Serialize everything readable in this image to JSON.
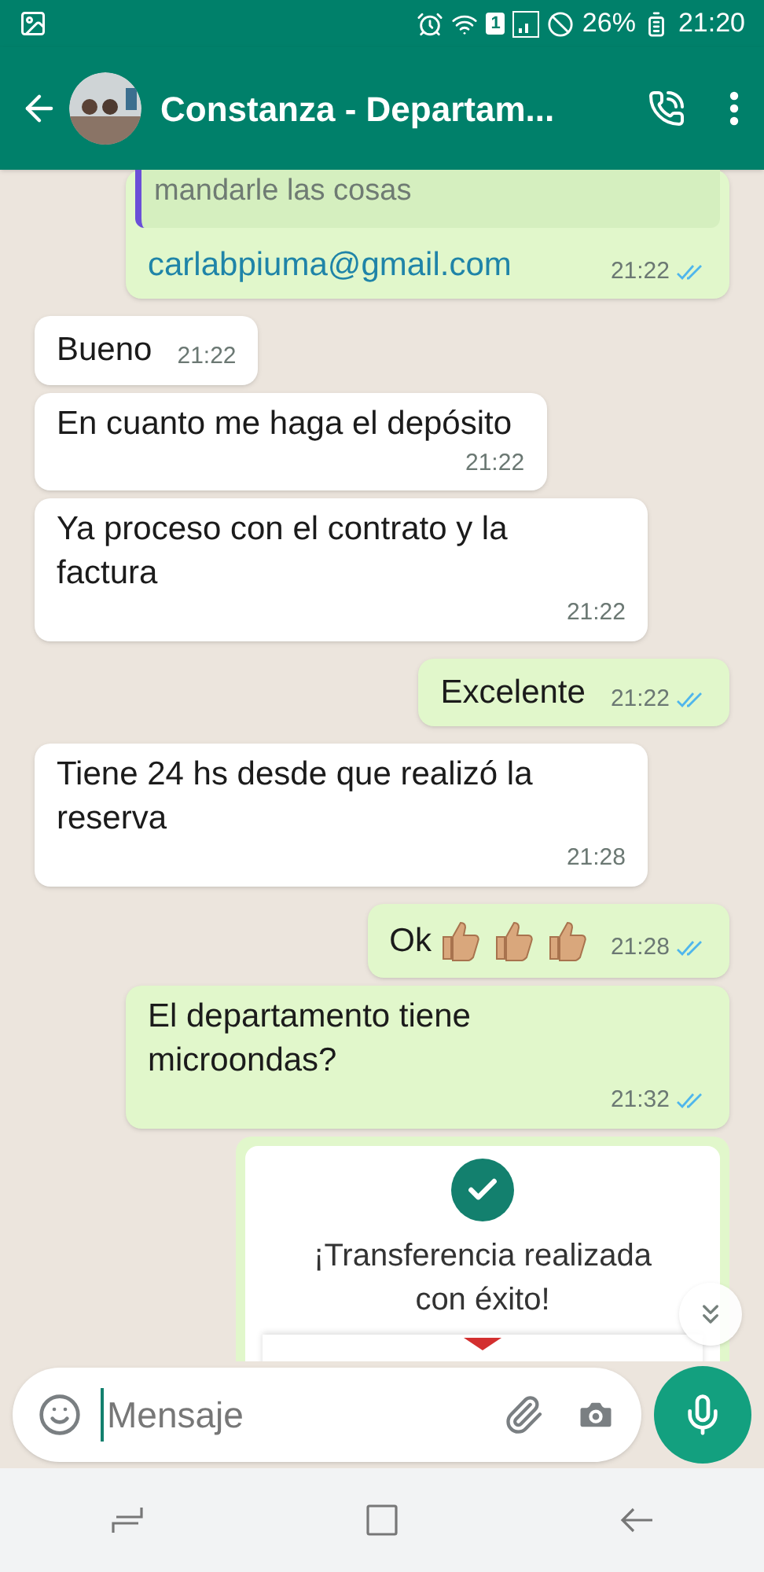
{
  "status_bar": {
    "battery": "26%",
    "time": "21:20",
    "sim": "1"
  },
  "header": {
    "title": "Constanza - Departam..."
  },
  "messages": [
    {
      "kind": "quoted",
      "outgoing": true,
      "quote": "mandarle las cosas",
      "link": "carlabpiuma@gmail.com",
      "time": "21:22",
      "read": true
    },
    {
      "kind": "text",
      "outgoing": false,
      "text": "Bueno",
      "time": "21:22",
      "inline": true
    },
    {
      "kind": "text",
      "outgoing": false,
      "text": "En cuanto me haga el depósito",
      "time": "21:22",
      "inline": false
    },
    {
      "kind": "text",
      "outgoing": false,
      "text": "Ya proceso con el contrato y la factura",
      "time": "21:22",
      "inline": false
    },
    {
      "kind": "text",
      "outgoing": true,
      "text": "Excelente",
      "time": "21:22",
      "read": true,
      "inline": true
    },
    {
      "kind": "text",
      "outgoing": false,
      "text": "Tiene 24 hs desde que realizó la reserva",
      "time": "21:28",
      "inline": false
    },
    {
      "kind": "emoji",
      "outgoing": true,
      "text": "Ok",
      "emoji": [
        {
          "kind": "thumbs-up"
        },
        {
          "kind": "thumbs-up"
        },
        {
          "kind": "thumbs-up"
        }
      ],
      "time": "21:28",
      "read": true
    },
    {
      "kind": "text",
      "outgoing": true,
      "text": "El departamento tiene microondas?",
      "time": "21:32",
      "read": true,
      "inline": false
    },
    {
      "kind": "card",
      "outgoing": true,
      "text": "¡Transferencia realizada con éxito!"
    }
  ],
  "composer": {
    "placeholder": "Mensaje"
  }
}
